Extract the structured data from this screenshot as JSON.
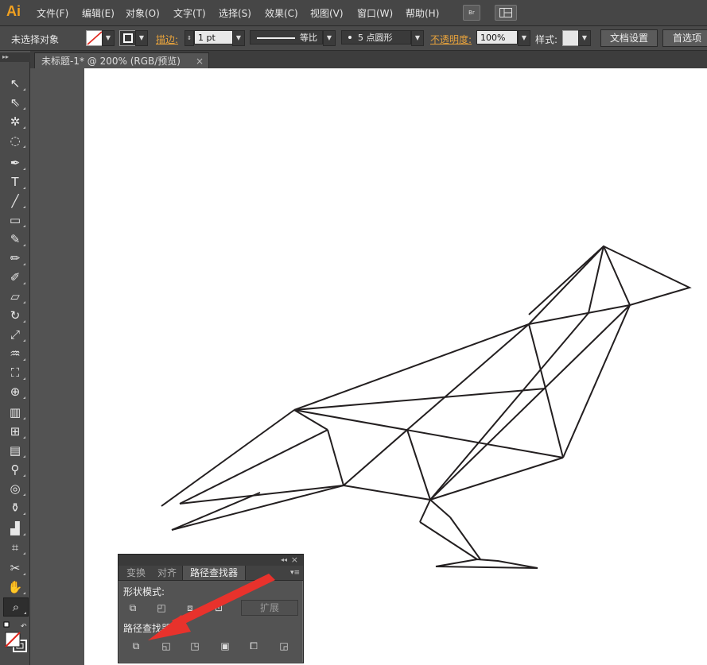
{
  "app": {
    "logo": "Ai",
    "menus": [
      "文件(F)",
      "编辑(E)",
      "对象(O)",
      "文字(T)",
      "选择(S)",
      "效果(C)",
      "视图(V)",
      "窗口(W)",
      "帮助(H)"
    ],
    "bridge_label": "Br"
  },
  "control_bar": {
    "selection_status": "未选择对象",
    "stroke_label": "描边:",
    "stroke_weight": "1 pt",
    "stroke_profile": "等比",
    "brush": "5 点圆形",
    "opacity_label": "不透明度:",
    "opacity_value": "100%",
    "style_label": "样式:",
    "doc_setup_button": "文档设置",
    "prefs_button": "首选项"
  },
  "document_tab": {
    "title": "未标题-1* @ 200% (RGB/预览)"
  },
  "pathfinder_panel": {
    "tabs": [
      "变换",
      "对齐",
      "路径查找器"
    ],
    "active_tab": "路径查找器",
    "shape_modes_label": "形状模式:",
    "expand_button": "扩展",
    "pathfinders_label": "路径查找器:"
  },
  "colors": {
    "annotation_arrow": "#e8322c",
    "artwork_stroke": "#231f20",
    "accent_label": "#e8a33c"
  }
}
